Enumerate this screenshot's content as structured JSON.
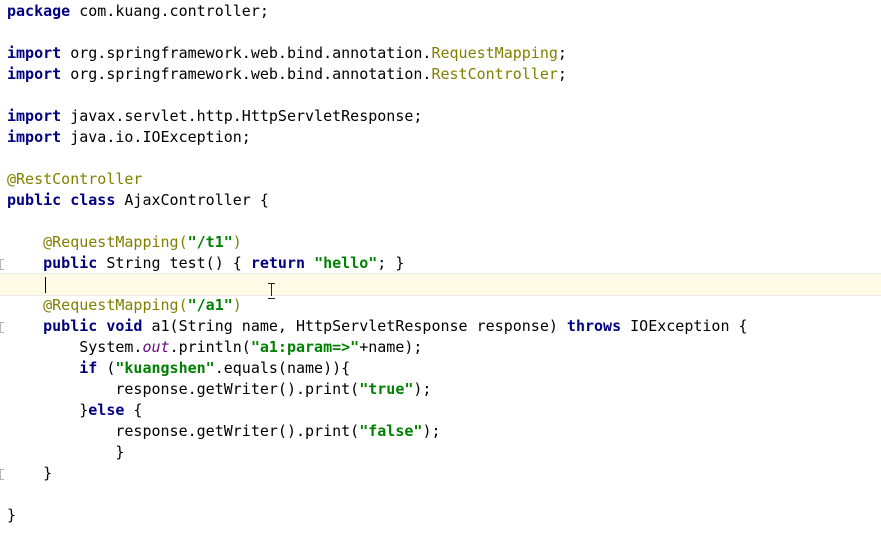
{
  "code": {
    "package_kw": "package",
    "package_name": " com.kuang.controller;",
    "imports": [
      {
        "kw": "import",
        "path": " org.springframework.web.bind.annotation.",
        "cls": "RequestMapping",
        "end": ";"
      },
      {
        "kw": "import",
        "path": " org.springframework.web.bind.annotation.",
        "cls": "RestController",
        "end": ";"
      },
      {
        "kw": "import",
        "path": " javax.servlet.http.HttpServletResponse;"
      },
      {
        "kw": "import",
        "path": " java.io.IOException;"
      }
    ],
    "class_annotation": "@RestController",
    "class_decl": {
      "public": "public",
      "class": "class",
      "rest": " AjaxController {"
    },
    "m1_annotation": "@RequestMapping(",
    "m1_path": "\"/t1\"",
    "m1_close": ")",
    "m1_public": "public",
    "m1_sig": " String test() { ",
    "m1_return": "return",
    "m1_str": "\"hello\"",
    "m1_end": "; }",
    "m2_annotation": "@RequestMapping(",
    "m2_path": "\"/a1\"",
    "m2_close": ")",
    "m2_public": "public",
    "m2_void": "void",
    "m2_sig": " a1(String name, HttpServletResponse response) ",
    "m2_throws": "throws",
    "m2_exc": " IOException {",
    "print_pre": "System.",
    "print_out": "out",
    "print_mid": ".println(",
    "print_str": "\"a1:param=>\"",
    "print_end": "+name);",
    "if_kw": "if",
    "if_pre": " (",
    "if_str": "\"kuangshen\"",
    "if_end": ".equals(name)){",
    "w1_pre": "response.getWriter().print(",
    "w1_str": "\"true\"",
    "w1_end": ");",
    "else_pre": "}",
    "else_kw": "else",
    "else_end": " {",
    "w2_pre": "response.getWriter().print(",
    "w2_str": "\"false\"",
    "w2_end": ");",
    "close_brace": "}"
  }
}
